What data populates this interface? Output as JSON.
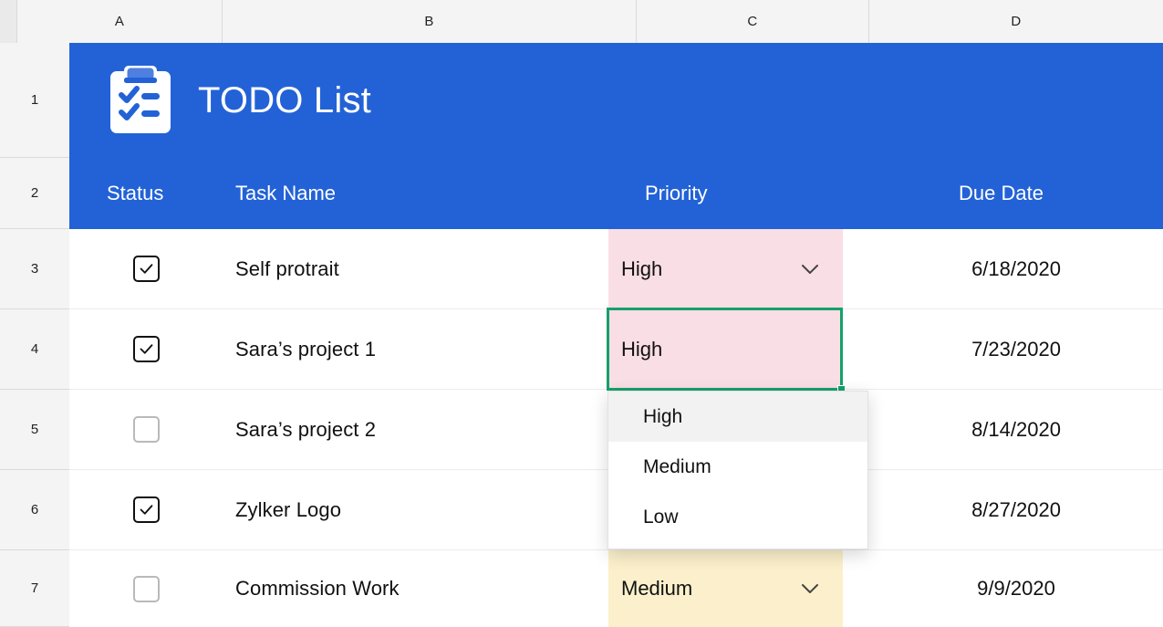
{
  "spreadsheet": {
    "column_headers": [
      "A",
      "B",
      "C",
      "D"
    ],
    "row_numbers": [
      "1",
      "2",
      "3",
      "4",
      "5",
      "6",
      "7"
    ]
  },
  "banner": {
    "title": "TODO List",
    "icon": "clipboard-checklist-icon",
    "background_color": "#2362d6"
  },
  "table": {
    "headers": {
      "status": "Status",
      "task_name": "Task Name",
      "priority": "Priority",
      "due_date": "Due Date"
    },
    "rows": [
      {
        "done": true,
        "task": "Self protrait",
        "priority": "High",
        "due": "6/18/2020"
      },
      {
        "done": true,
        "task": "Sara’s project 1",
        "priority": "High",
        "due": "7/23/2020"
      },
      {
        "done": false,
        "task": "Sara’s project 2",
        "priority": "",
        "due": "8/14/2020"
      },
      {
        "done": true,
        "task": "Zylker Logo",
        "priority": "",
        "due": "8/27/2020"
      },
      {
        "done": false,
        "task": "Commission Work",
        "priority": "Medium",
        "due": "9/9/2020"
      }
    ]
  },
  "dropdown": {
    "options": [
      "High",
      "Medium",
      "Low"
    ],
    "selected": "High"
  },
  "colors": {
    "accent_blue": "#2362d6",
    "priority_high_bg": "#fadee5",
    "priority_medium_bg": "#fbf0cb",
    "selection_green": "#16a06a"
  }
}
